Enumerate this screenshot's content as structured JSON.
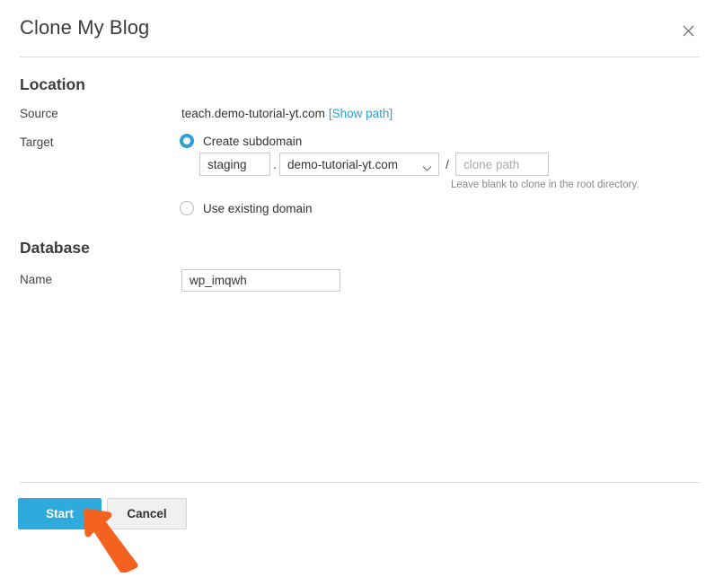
{
  "dialog": {
    "title": "Clone My Blog",
    "close_icon": "close-icon"
  },
  "location": {
    "heading": "Location",
    "source": {
      "label": "Source",
      "value": "teach.demo-tutorial-yt.com",
      "show_path_link": "[Show path]"
    },
    "target": {
      "label": "Target",
      "options": [
        {
          "id": "create-subdomain",
          "label": "Create subdomain",
          "selected": true
        },
        {
          "id": "use-existing-domain",
          "label": "Use existing domain",
          "selected": false
        }
      ],
      "subdomain_input": {
        "value": "staging",
        "placeholder": "subdomain"
      },
      "dot_separator": ".",
      "domain_select": {
        "value": "demo-tutorial-yt.com",
        "options": [
          "demo-tutorial-yt.com"
        ],
        "caret_icon": "chevron-down-icon"
      },
      "path_separator": "/",
      "clone_path_input": {
        "value": "",
        "placeholder": "clone path"
      },
      "hint": "Leave blank to clone in the root directory."
    }
  },
  "database": {
    "heading": "Database",
    "name": {
      "label": "Name",
      "value": "wp_imqwh",
      "placeholder": "database name"
    }
  },
  "footer": {
    "start_label": "Start",
    "cancel_label": "Cancel"
  },
  "annotation": {
    "arrow_icon": "arrow-pointer-annotation",
    "color": "#f4621f",
    "points_at": "Start"
  },
  "colors": {
    "accent_blue": "#2eaadc",
    "link_blue": "#2e9fd4",
    "radio_blue": "#2e9fd4",
    "border_gray": "#c6c9cc",
    "divider_gray": "#d8dade",
    "cancel_bg": "#f0f0f0",
    "hint_gray": "#87888a",
    "annotation_orange": "#f4621f"
  }
}
